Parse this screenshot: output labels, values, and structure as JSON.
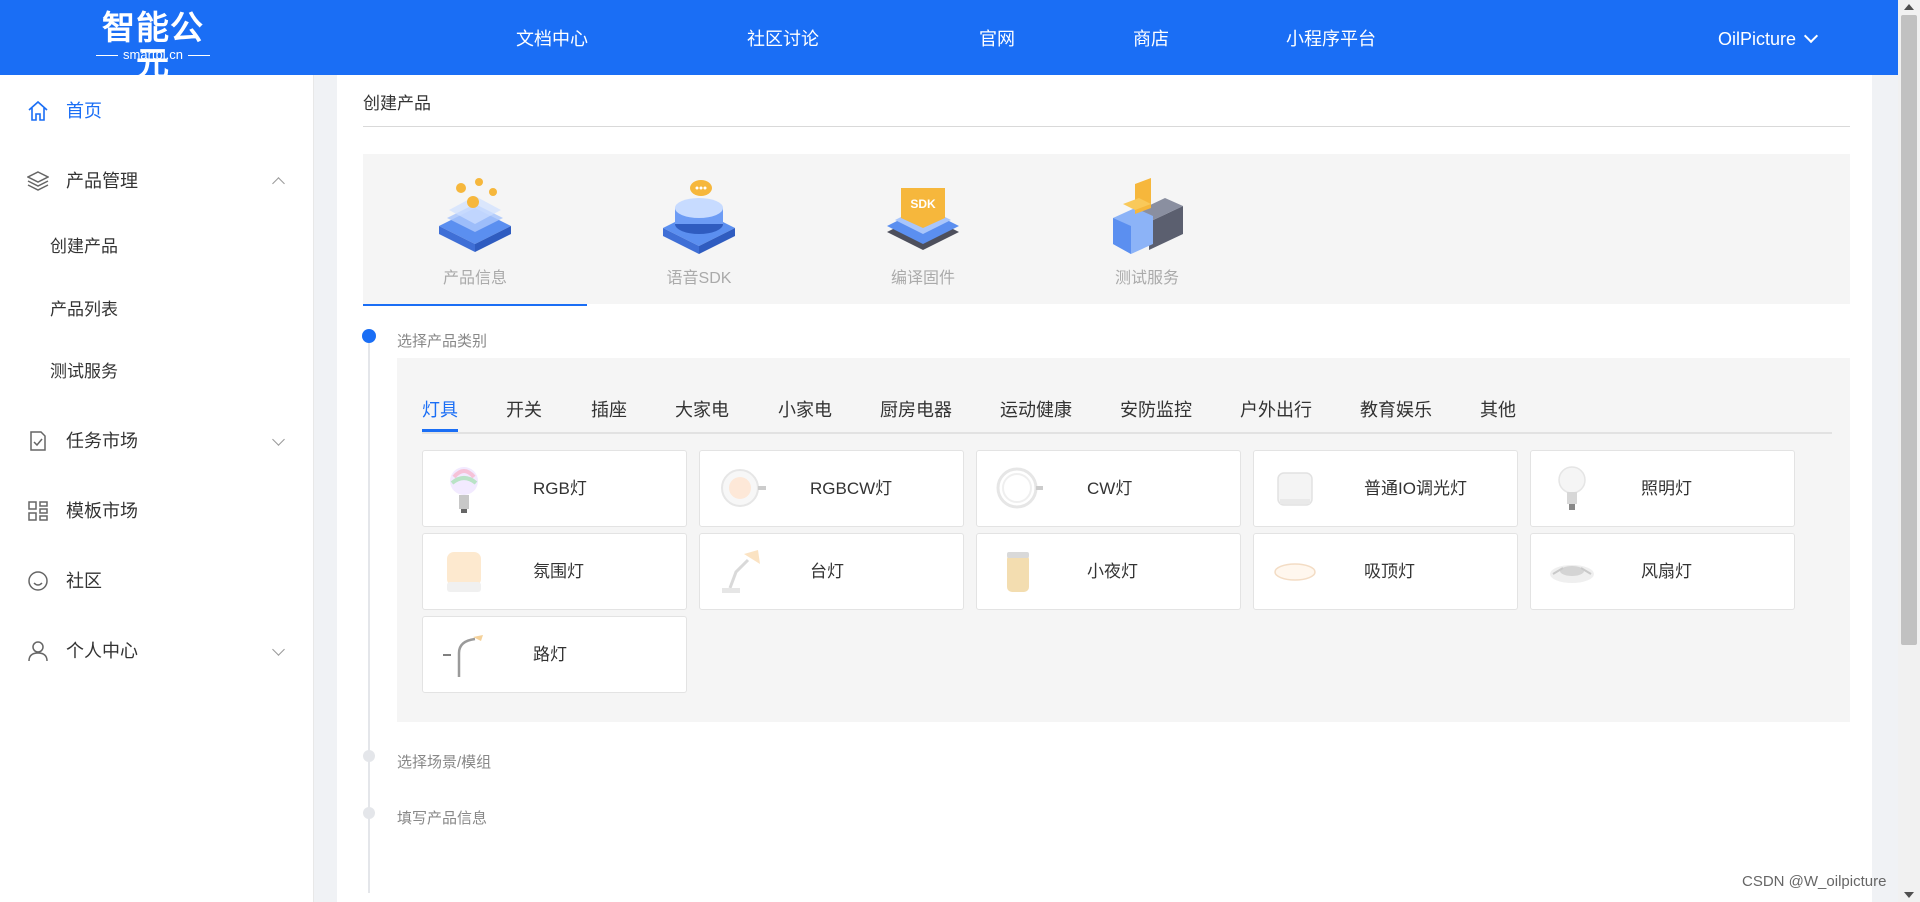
{
  "header": {
    "logo_main": "智能公元",
    "logo_sub": "smartpi.cn",
    "nav": [
      {
        "label": "文档中心"
      },
      {
        "label": "社区讨论"
      },
      {
        "label": "官网"
      },
      {
        "label": "商店"
      },
      {
        "label": "小程序平台"
      }
    ],
    "user": "OilPicture",
    "user_icon": "chevron-down-icon"
  },
  "sidebar": {
    "items": [
      {
        "label": "首页",
        "icon": "home-icon",
        "active": true
      },
      {
        "label": "产品管理",
        "icon": "layers-icon",
        "expanded": true,
        "children": [
          {
            "label": "创建产品"
          },
          {
            "label": "产品列表"
          },
          {
            "label": "测试服务"
          }
        ]
      },
      {
        "label": "任务市场",
        "icon": "task-icon"
      },
      {
        "label": "模板市场",
        "icon": "grid-icon"
      },
      {
        "label": "社区",
        "icon": "smile-icon"
      },
      {
        "label": "个人中心",
        "icon": "user-icon"
      }
    ]
  },
  "main": {
    "heading": "创建产品",
    "steps": [
      {
        "label": "产品信息",
        "active": true
      },
      {
        "label": "语音SDK"
      },
      {
        "label": "编译固件"
      },
      {
        "label": "测试服务"
      }
    ],
    "timeline": [
      {
        "label": "选择产品类别",
        "active": true
      },
      {
        "label": "选择场景/模组"
      },
      {
        "label": "填写产品信息"
      }
    ],
    "categories": [
      "灯具",
      "开关",
      "插座",
      "大家电",
      "小家电",
      "厨房电器",
      "运动健康",
      "安防监控",
      "户外出行",
      "教育娱乐",
      "其他"
    ],
    "active_category": "灯具",
    "products": [
      {
        "name": "RGB灯",
        "icon": "bulb-rgb-icon"
      },
      {
        "name": "RGBCW灯",
        "icon": "round-panel-light-icon"
      },
      {
        "name": "CW灯",
        "icon": "ring-light-icon"
      },
      {
        "name": "普通IO调光灯",
        "icon": "box-light-icon"
      },
      {
        "name": "照明灯",
        "icon": "bulb-icon"
      },
      {
        "name": "氛围灯",
        "icon": "ambient-light-icon"
      },
      {
        "name": "台灯",
        "icon": "desk-lamp-icon"
      },
      {
        "name": "小夜灯",
        "icon": "night-light-icon"
      },
      {
        "name": "吸顶灯",
        "icon": "ceiling-light-icon"
      },
      {
        "name": "风扇灯",
        "icon": "fan-light-icon"
      },
      {
        "name": "路灯",
        "icon": "street-light-icon"
      }
    ]
  },
  "watermark": "CSDN @W_oilpicture",
  "colors": {
    "brand": "#1a6ef5",
    "panel": "#f5f5f5",
    "muted": "#aaaaaa"
  }
}
